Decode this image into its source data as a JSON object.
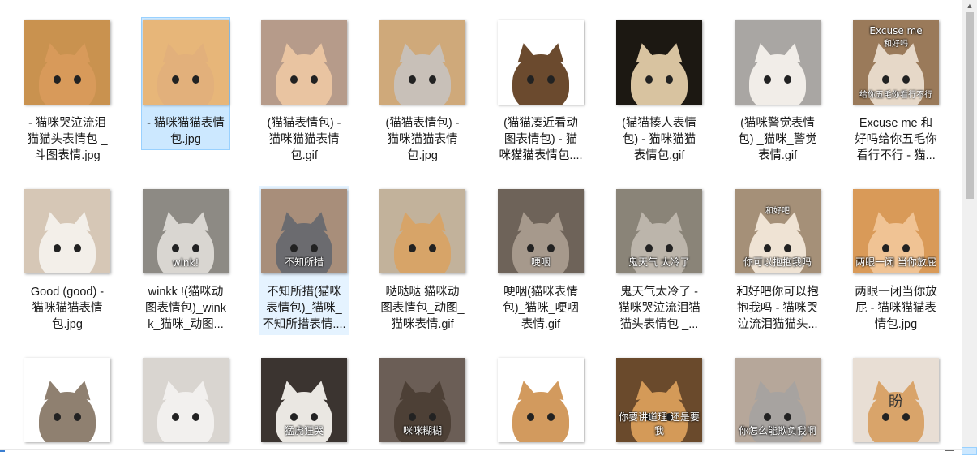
{
  "files": [
    {
      "name": "- 猫咪哭泣流泪猫猫头表情包 _斗图表情.jpg",
      "state": "normal",
      "bg": "#c9924f",
      "cat": "#d89a5a",
      "caption": ""
    },
    {
      "name": "- 猫咪猫猫表情包.jpg",
      "state": "selected",
      "bg": "#e7b679",
      "cat": "#e2b07b",
      "caption": ""
    },
    {
      "name": "(猫猫表情包) - 猫咪猫猫表情包.gif",
      "state": "normal",
      "bg": "#b69b8a",
      "cat": "#e9c4a1",
      "caption": ""
    },
    {
      "name": "(猫猫表情包) - 猫咪猫猫表情包.jpg",
      "state": "normal",
      "bg": "#cfa97a",
      "cat": "#c8c0b8",
      "caption": ""
    },
    {
      "name": "(猫猫凑近看动图表情包) - 猫咪猫猫表情包.gif",
      "state": "normal",
      "bg": "#ffffff",
      "cat": "#6b4a2e",
      "caption": ""
    },
    {
      "name": "(猫猫揍人表情包) - 猫咪猫猫表情包.gif",
      "state": "normal",
      "bg": "#1c1812",
      "cat": "#d8c3a0",
      "caption": ""
    },
    {
      "name": "(猫咪警觉表情包) _猫咪_警觉表情.gif",
      "state": "normal",
      "bg": "#a9a6a3",
      "cat": "#f1ede8",
      "caption": ""
    },
    {
      "name": "Excuse me 和好吗给你五毛你看行不行 - 猫咪哭泣流泪猫猫头表情包 _斗图表情.jpg",
      "state": "normal",
      "bg": "#9a7a5a",
      "cat": "#e6d8c8",
      "caption": "Excuse me",
      "caption2": "和好吗",
      "caption3": "给你五毛你看行不行"
    },
    {
      "name": "Good (good) - 猫咪猫猫表情包.jpg",
      "state": "normal",
      "bg": "#d6c7b6",
      "cat": "#f3efe9",
      "caption": ""
    },
    {
      "name": "winkk !(猫咪动图表情包)_winkk_猫咪_动图表情.gif",
      "state": "normal",
      "bg": "#8d8a84",
      "cat": "#d9d6d1",
      "caption": "wink!"
    },
    {
      "name": "不知所措(猫咪表情包)_猫咪_不知所措表情.jpg",
      "state": "hover",
      "bg": "#a88e7a",
      "cat": "#6b6b6f",
      "caption": "不知所措"
    },
    {
      "name": "哒哒哒 猫咪动图表情包_动图_猫咪表情.gif",
      "state": "normal",
      "bg": "#c2b29b",
      "cat": "#d7a468",
      "caption": ""
    },
    {
      "name": "哽咽(猫咪表情包)_猫咪_哽咽表情.gif",
      "state": "normal",
      "bg": "#6e6359",
      "cat": "#a6998c",
      "caption": "哽咽"
    },
    {
      "name": "鬼天气太冷了 - 猫咪哭泣流泪猫猫头表情包 _斗图表情.jpg",
      "state": "normal",
      "bg": "#8a8478",
      "cat": "#bcb5ab",
      "caption": "鬼天气 太冷了"
    },
    {
      "name": "和好吧你可以抱抱我吗 - 猫咪哭泣流泪猫猫头表情包 _斗图表情.jpg",
      "state": "normal",
      "bg": "#a59078",
      "cat": "#efe3d4",
      "caption": "你可以抱抱我吗",
      "caption2": "和好吧"
    },
    {
      "name": "两眼一闭当你放屁 - 猫咪猫猫表情包.jpg",
      "state": "normal",
      "bg": "#d99a58",
      "cat": "#f0c394",
      "caption": "两眼一闭 当你放屁"
    },
    {
      "name": "",
      "state": "normal",
      "bg": "#ffffff",
      "cat": "#8f8070",
      "caption": ""
    },
    {
      "name": "",
      "state": "normal",
      "bg": "#d9d5d0",
      "cat": "#f2f0ee",
      "caption": ""
    },
    {
      "name": "",
      "state": "normal",
      "bg": "#3b3430",
      "cat": "#eae7e2",
      "caption": "猛虎狂哭"
    },
    {
      "name": "",
      "state": "normal",
      "bg": "#6b5e56",
      "cat": "#4d4036",
      "caption": "咪咪糊糊"
    },
    {
      "name": "",
      "state": "normal",
      "bg": "#ffffff",
      "cat": "#d29a5e",
      "caption": ""
    },
    {
      "name": "",
      "state": "normal",
      "bg": "#6a4a2c",
      "cat": "#d49a58",
      "caption": "你要讲道理 还是要我"
    },
    {
      "name": "",
      "state": "normal",
      "bg": "#b6a79a",
      "cat": "#a7a3a0",
      "caption": "你怎么能欺负我啊"
    },
    {
      "name": "",
      "state": "normal",
      "bg": "#e8ded4",
      "cat": "#d9a46a",
      "caption": "盼"
    }
  ]
}
